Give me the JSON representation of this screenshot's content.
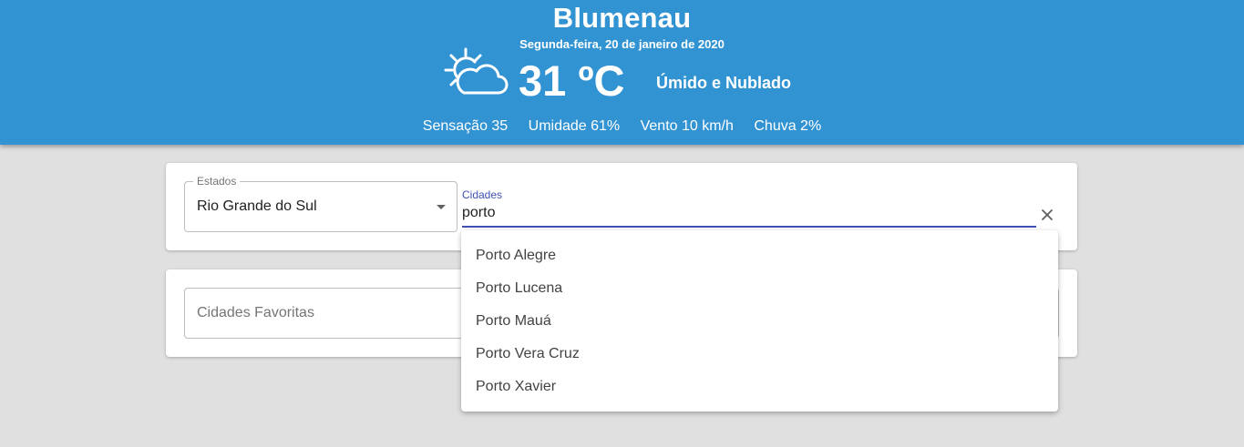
{
  "header": {
    "city": "Blumenau",
    "date": "Segunda-feira, 20 de janeiro de 2020",
    "weather_icon": "partly-cloudy-day-icon",
    "temperature": "31 ºC",
    "condition": "Úmido e Nublado",
    "stats": {
      "feels_like": "Sensação 35",
      "humidity": "Umidade 61%",
      "wind": "Vento 10 km/h",
      "rain": "Chuva 2%"
    }
  },
  "filters": {
    "states_label": "Estados",
    "states_value": "Rio Grande do Sul",
    "cities_label": "Cidades",
    "cities_value": "porto"
  },
  "favorites": {
    "placeholder": "Cidades Favoritas"
  },
  "dropdown": {
    "options": [
      "Porto Alegre",
      "Porto Lucena",
      "Porto Mauá",
      "Porto Vera Cruz",
      "Porto Xavier"
    ]
  },
  "colors": {
    "header_bg": "#3293d3",
    "accent": "#3f51b5",
    "page_bg": "#e0e0e0"
  }
}
